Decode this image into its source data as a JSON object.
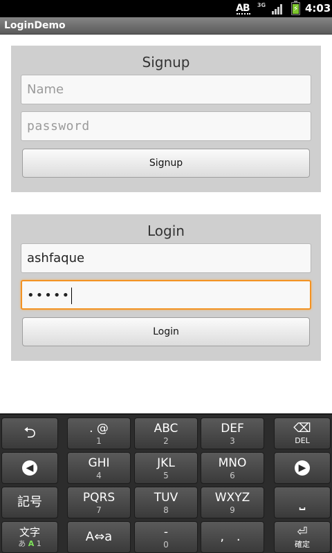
{
  "status_bar": {
    "ab_label": "AB",
    "network_label_top": "3G",
    "network_label_bottom": "",
    "time": "4:03"
  },
  "app": {
    "title": "LoginDemo"
  },
  "signup": {
    "title": "Signup",
    "name_placeholder": "Name",
    "password_placeholder": "password",
    "button_label": "Signup"
  },
  "login": {
    "title": "Login",
    "username_value": "ashfaque",
    "password_mask": "•••••",
    "button_label": "Login"
  },
  "keyboard": {
    "enter_icon": "⮌",
    "punct": {
      "main": ". @",
      "sub": "1"
    },
    "abc": {
      "main": "ABC",
      "sub": "2"
    },
    "def": {
      "main": "DEF",
      "sub": "3"
    },
    "del": {
      "icon": "⌫",
      "sub": "DEL"
    },
    "left_icon": "◀",
    "ghi": {
      "main": "GHI",
      "sub": "4"
    },
    "jkl": {
      "main": "JKL",
      "sub": "5"
    },
    "mno": {
      "main": "MNO",
      "sub": "6"
    },
    "right_icon": "▶",
    "kigo": "記号",
    "pqrs": {
      "main": "PQRS",
      "sub": "7"
    },
    "tuv": {
      "main": "TUV",
      "sub": "8"
    },
    "wxyz": {
      "main": "WXYZ",
      "sub": "9"
    },
    "space_icon": "⎵",
    "moji": {
      "main": "文字",
      "sub_a": "あ",
      "sub_b": "A",
      "sub_c": "1"
    },
    "case_toggle": "A⇔a",
    "zero": {
      "main": "-",
      "sub": "0"
    },
    "comma_period": ", .",
    "confirm": {
      "icon": "⏎",
      "sub": "確定"
    }
  },
  "colors": {
    "focus_border": "#f39222",
    "panel_background": "#cfcfcf",
    "keyboard_background": "#2c2c2c"
  }
}
